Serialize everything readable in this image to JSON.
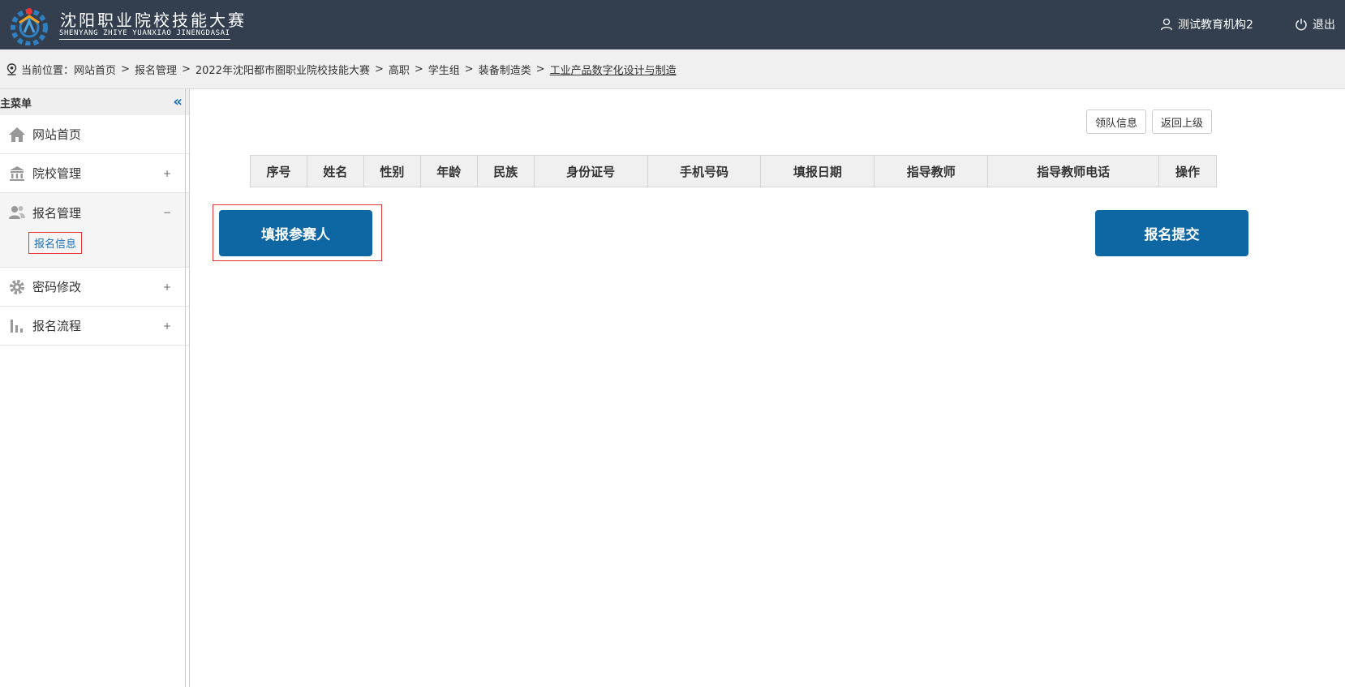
{
  "header": {
    "logo_title": "沈阳职业院校技能大赛",
    "logo_subtitle": "SHENYANG ZHIYE YUANXIAO JINENGDASAI",
    "user_name": "测试教育机构2",
    "logout_label": "退出"
  },
  "breadcrumb": {
    "prefix": "当前位置：",
    "items": [
      "网站首页",
      "报名管理",
      "2022年沈阳都市圈职业院校技能大赛",
      "高职",
      "学生组",
      "装备制造类"
    ],
    "separator": ">",
    "current": "工业产品数字化设计与制造"
  },
  "sidebar": {
    "title": "主菜单",
    "collapse_icon": "«",
    "items": [
      {
        "label": "网站首页",
        "icon": "home-icon",
        "toggle": ""
      },
      {
        "label": "院校管理",
        "icon": "building-icon",
        "toggle": "+"
      },
      {
        "label": "报名管理",
        "icon": "users-icon",
        "toggle": "−",
        "children": [
          {
            "label": "报名信息"
          }
        ]
      },
      {
        "label": "密码修改",
        "icon": "gear-icon",
        "toggle": "+"
      },
      {
        "label": "报名流程",
        "icon": "bar-chart-icon",
        "toggle": "+"
      }
    ]
  },
  "main": {
    "team_info_label": "领队信息",
    "back_label": "返回上级",
    "table_headers": [
      "序号",
      "姓名",
      "性别",
      "年龄",
      "民族",
      "身份证号",
      "手机号码",
      "填报日期",
      "指导教师",
      "指导教师电话",
      "操作"
    ],
    "fill_participant_label": "填报参赛人",
    "submit_label": "报名提交"
  },
  "colors": {
    "header_bg": "#333f4f",
    "primary": "#0e67a3",
    "highlight": "#e53535",
    "link": "#1e6fb8"
  }
}
